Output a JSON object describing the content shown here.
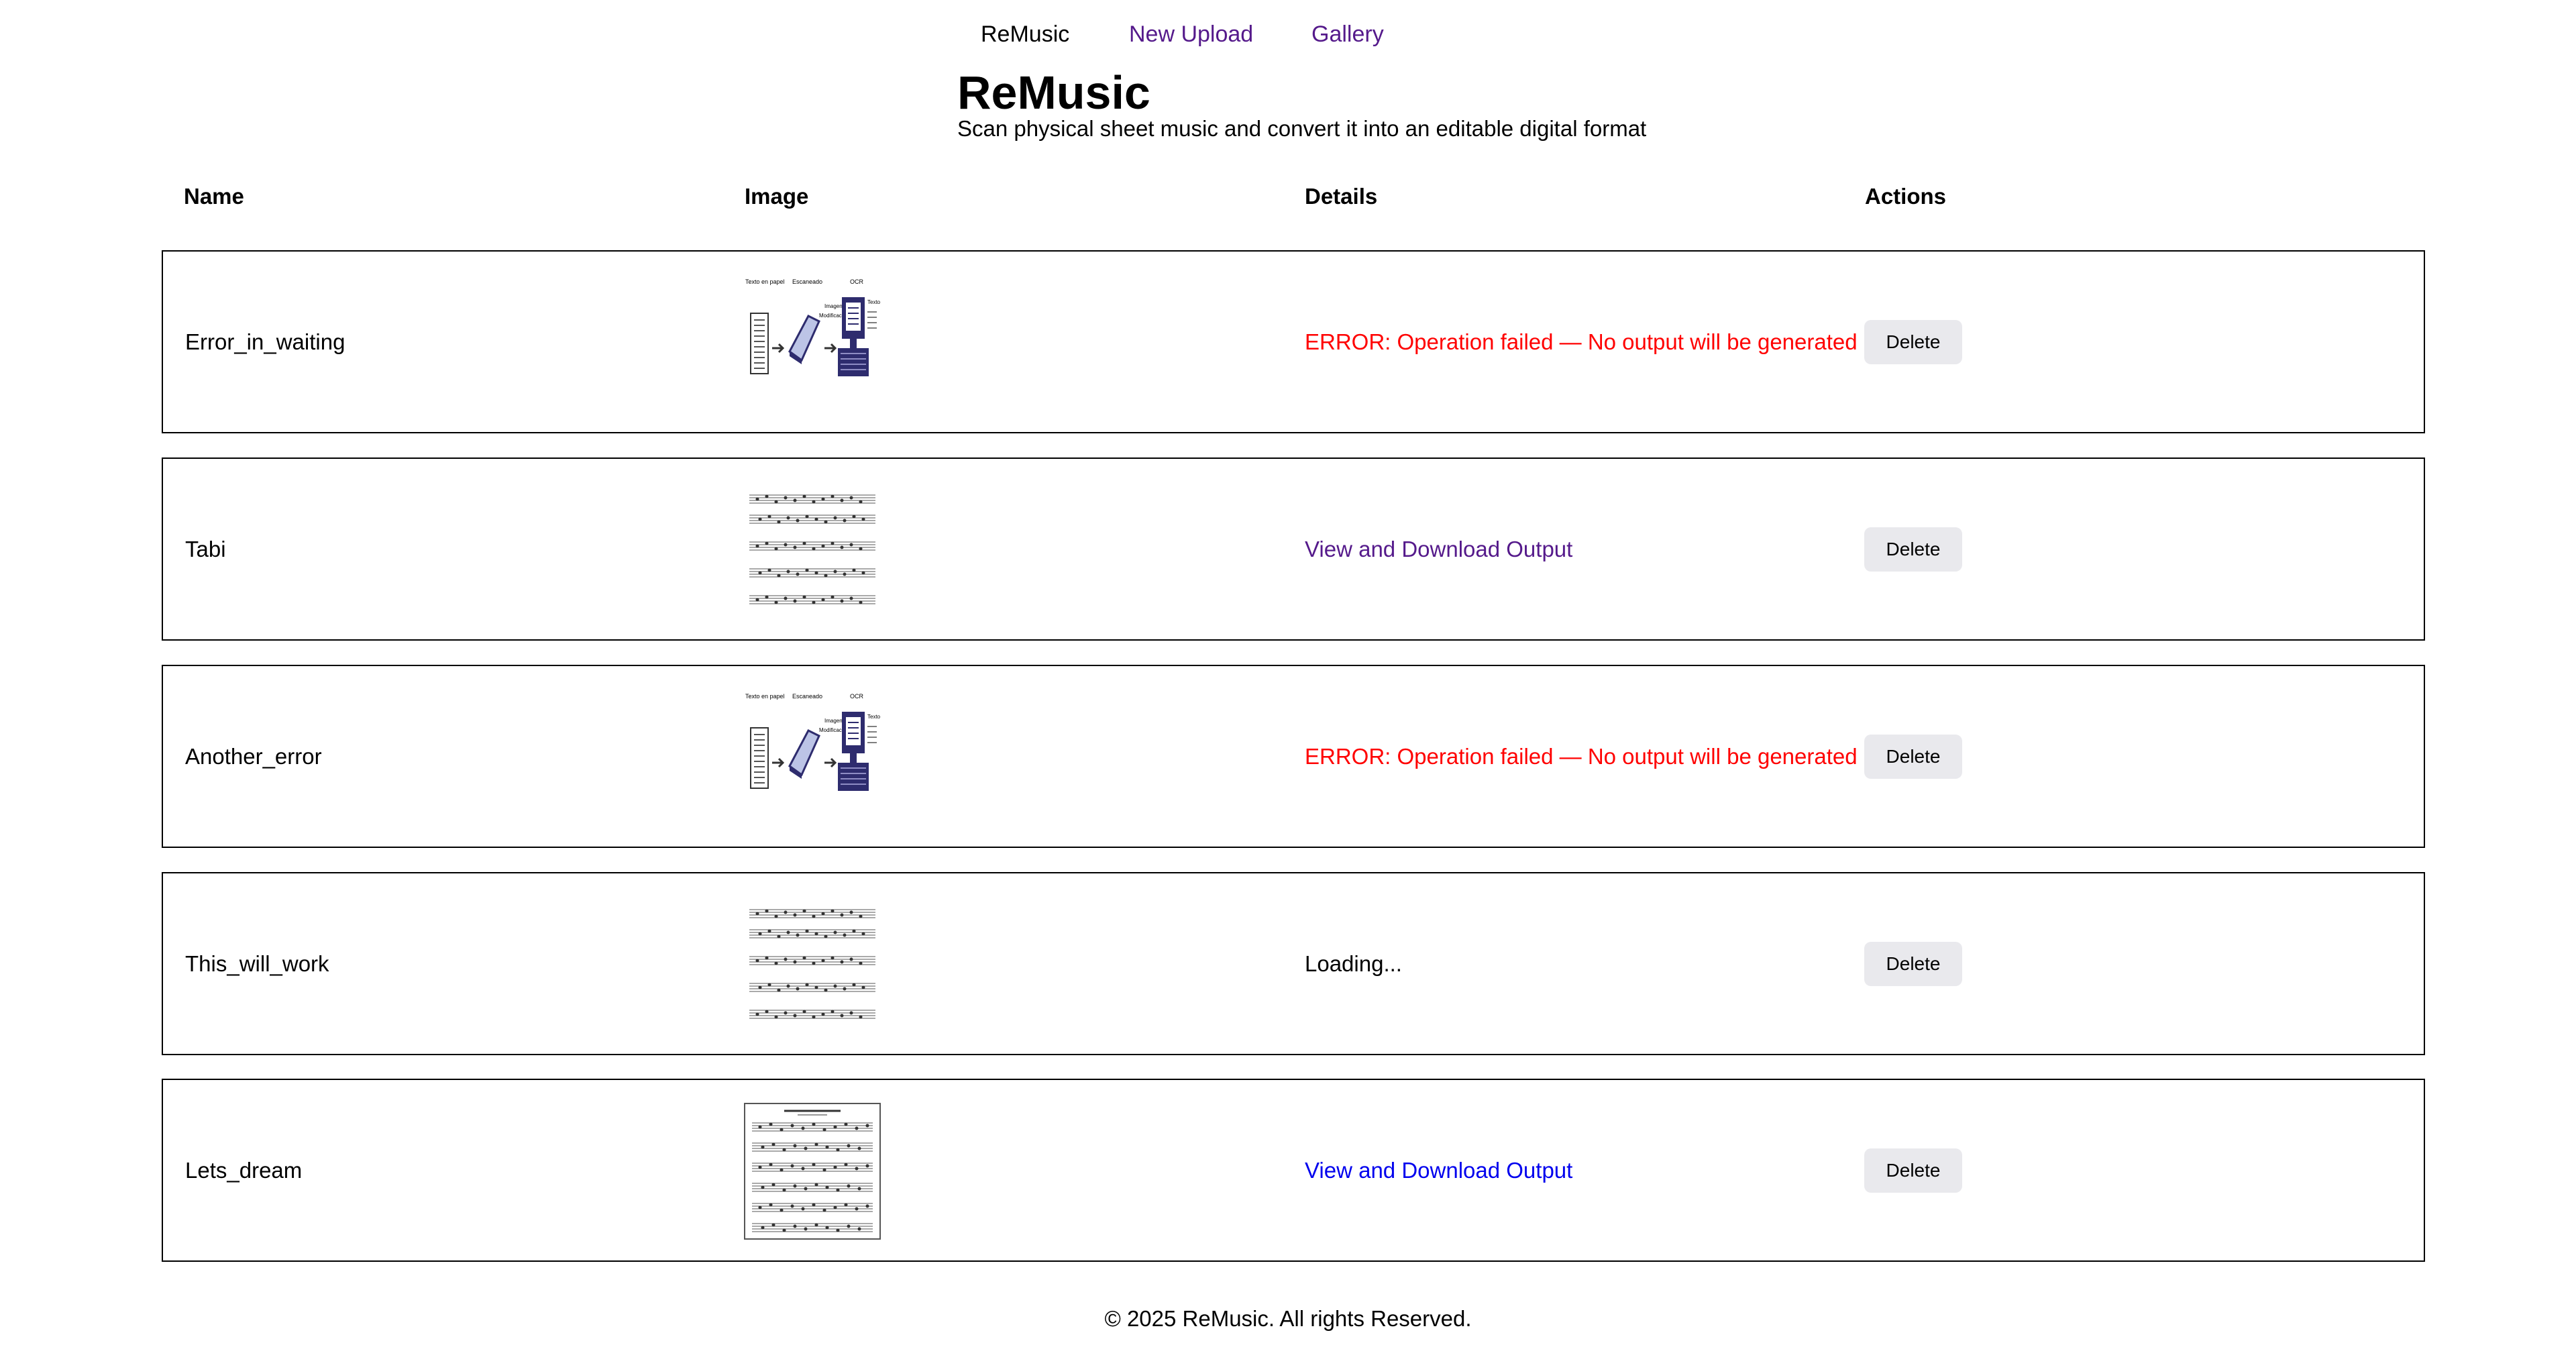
{
  "nav": {
    "brand": "ReMusic",
    "new_upload": "New Upload",
    "gallery": "Gallery"
  },
  "header": {
    "title": "ReMusic",
    "subtitle": "Scan physical sheet music and convert it into an editable digital format"
  },
  "table": {
    "columns": [
      "Name",
      "Image",
      "Details",
      "Actions"
    ],
    "rows": [
      {
        "name": "Error_in_waiting",
        "image_icon": "ocr-diagram-thumbnail",
        "image_labels": [
          "Texto en papel",
          "Escaneado",
          "OCR",
          "Imagen",
          "Modificación",
          "Texto"
        ],
        "details": "ERROR: Operation failed — No output will be generated",
        "details_status": "error",
        "action": "Delete"
      },
      {
        "name": "Tabi",
        "image_icon": "sheet-music-thumbnail",
        "details": "View and Download Output",
        "details_status": "link-visited",
        "action": "Delete"
      },
      {
        "name": "Another_error",
        "image_icon": "ocr-diagram-thumbnail",
        "image_labels": [
          "Texto en papel",
          "Escaneado",
          "OCR",
          "Imagen",
          "Modificación",
          "Texto"
        ],
        "details": "ERROR: Operation failed — No output will be generated",
        "details_status": "error",
        "action": "Delete"
      },
      {
        "name": "This_will_work",
        "image_icon": "sheet-music-thumbnail",
        "details": "Loading...",
        "details_status": "loading",
        "action": "Delete"
      },
      {
        "name": "Lets_dream",
        "image_icon": "sheet-music-framed-thumbnail",
        "details": "View and Download Output",
        "details_status": "link",
        "action": "Delete"
      }
    ]
  },
  "colors": {
    "error": "#ff0000",
    "link_visited": "#551a8b",
    "link": "#0000ee",
    "button_bg": "#e9e9ed",
    "diagram_navy": "#2e2c6e"
  },
  "footer": {
    "text": "© 2025 ReMusic. All rights Reserved."
  }
}
